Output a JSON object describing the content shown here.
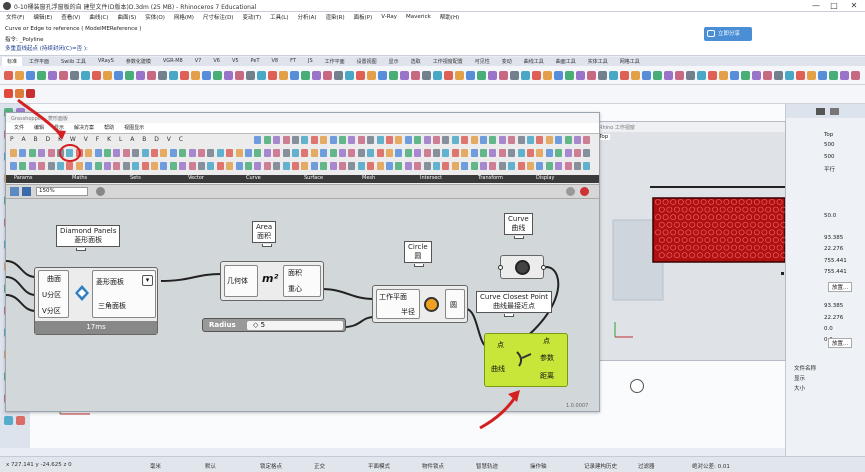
{
  "titlebar": {
    "title": "0-10桶装窗孔浮窗板的自 建型文件(D版本)D.3dm (25 MB) - Rhinoceros 7 Educational",
    "min": "—",
    "max": "□",
    "close": "✕"
  },
  "menubar": [
    "文件(F)",
    "编辑(E)",
    "查看(V)",
    "曲线(C)",
    "曲面(S)",
    "实体(O)",
    "网格(M)",
    "尺寸标注(D)",
    "变动(T)",
    "工具(L)",
    "分析(A)",
    "渲染(R)",
    "面板(P)",
    "V-Ray",
    "Maverick",
    "帮助(H)"
  ],
  "command": {
    "line1": "Curve or Edge to reference ( ModelMEReference )",
    "line2": "指令: _Polyline",
    "line3": "多重直线起点 (持续封闭(C)=否 ):",
    "share_button": "立即分享"
  },
  "tabs": [
    "标准",
    "工作平面",
    "Swiib 工具",
    "VRayS",
    "参数化建模",
    "VGR-M8",
    "V7",
    "V6",
    "V5",
    "PeT",
    "V8",
    "FT",
    "JS",
    "工作平面",
    "设置视图",
    "显示",
    "选取",
    "工作视窗配置",
    "可见性",
    "变动",
    "曲线工具",
    "曲面工具",
    "实体工具",
    "网格工具"
  ],
  "grasshopper": {
    "title": "Grasshopper - 菱形面板",
    "menu": [
      "文件",
      "编辑",
      "显示",
      "解决方案",
      "帮助",
      "视图显示"
    ],
    "toolbar_letters": "P A B D K W V F K L A B D V C",
    "categories": [
      "Params",
      "Maths",
      "Sets",
      "Vector",
      "Curve",
      "Surface",
      "Mesh",
      "Intersect",
      "Transform",
      "Display"
    ],
    "zoom": "150%",
    "components": {
      "diamond": {
        "bubble_en": "Diamond Panels",
        "bubble_cn": "菱形面板",
        "in1": "曲面",
        "in2": "U分区",
        "in3": "V分区",
        "out1": "菱形面板",
        "out2": "三角面板",
        "time": "17ms"
      },
      "area": {
        "bubble_en": "Area",
        "bubble_cn": "面积",
        "in1": "几何体",
        "out1": "面积",
        "out2": "重心",
        "icon": "m²"
      },
      "circle": {
        "bubble_en": "Circle",
        "bubble_cn": "圆",
        "in1": "工作平面",
        "in2": "半径",
        "out1": "圆"
      },
      "curve": {
        "bubble_en": "Curve",
        "bubble_cn": "曲线"
      },
      "ccp": {
        "bubble_en": "Curve Closest Point",
        "bubble_cn": "曲线最接近点",
        "in1": "点",
        "in2": "曲线",
        "out1": "点",
        "out2": "参数",
        "out3": "距离"
      },
      "radius": {
        "label": "Radius",
        "value": "◇ 5"
      }
    },
    "version": "1.0.0007"
  },
  "rhino_viewport": {
    "title": "Rhino 工作视窗",
    "view": "Top"
  },
  "right_panel": {
    "tab": "Top",
    "values": [
      "500",
      "500",
      "平行",
      "",
      "50.0",
      "93.385",
      "22.276",
      "755.441",
      "755.441",
      "",
      "93.385",
      "22.276",
      "0.0",
      "0.0"
    ],
    "btn1": "放置...",
    "btn2": "放置...",
    "row1": "文件名称",
    "row2": "显示",
    "row3": "大小"
  },
  "status": {
    "coords": "x 727.141  y -24.625  z 0",
    "units": "毫米",
    "layer": "默认",
    "items": [
      "锁定格点",
      "正交",
      "平面模式",
      "物件锁点",
      "智慧轨迹",
      "操作轴",
      "记录建构历史",
      "过滤器",
      "绝对公差: 0.01"
    ]
  },
  "colors": {
    "panel_fill": "#b01010",
    "ccp_fill": "#c8e63a",
    "arrow": "#d42020",
    "accent": "#4a8fd6"
  }
}
